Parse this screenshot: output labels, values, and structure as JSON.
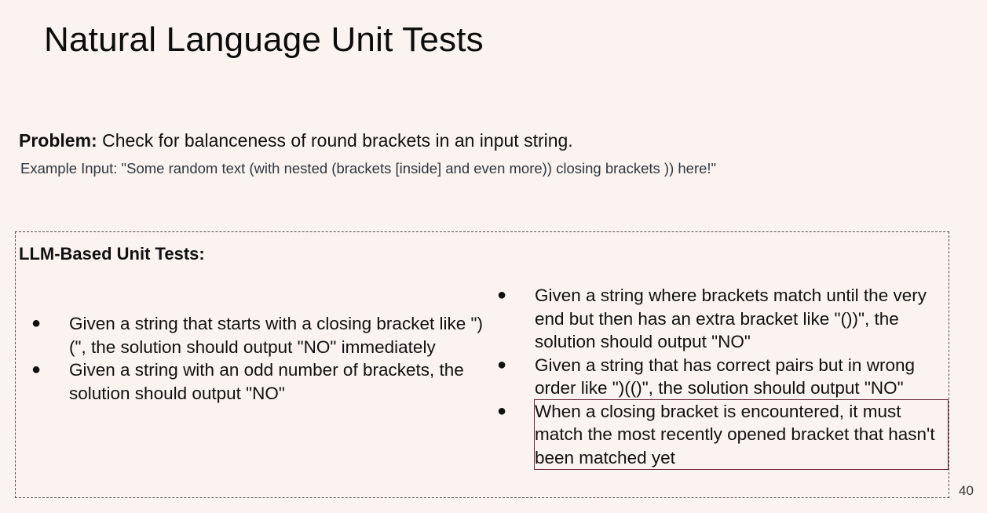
{
  "slide": {
    "title": "Natural Language Unit Tests",
    "problem_label": "Problem:",
    "problem_text": " Check for balanceness of round brackets in an input string.",
    "example_text": "Example Input: \"Some random text (with nested (brackets [inside] and even more)) closing brackets )) here!\"",
    "tests_heading": "LLM-Based Unit Tests:",
    "bullet_symbol": "●",
    "left_tests": [
      "Given a string that starts with a closing bracket like \")(\", the solution should output \"NO\" immediately",
      "Given a string with an odd number of brackets, the solution should output \"NO\""
    ],
    "right_tests": [
      "Given a string where brackets match until the very end but then has an extra bracket like \"())\", the solution should output \"NO\"",
      "Given a string that has correct pairs but in wrong order like \")(()\", the solution should output \"NO\"",
      "When a closing bracket is encountered, it must match the most recently opened bracket that hasn't been matched yet"
    ],
    "page_number": "40"
  },
  "colors": {
    "background": "#faf3ef",
    "highlight_border": "#6a2a3a",
    "example_text": "#2e3640"
  }
}
